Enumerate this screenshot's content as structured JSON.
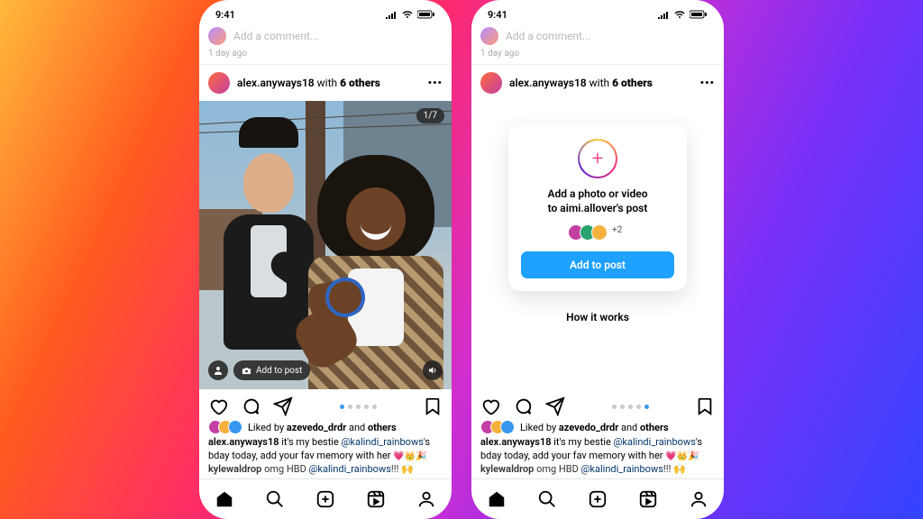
{
  "status": {
    "time": "9:41"
  },
  "prev_comment": {
    "placeholder": "Add a comment...",
    "timestamp": "1 day ago"
  },
  "post": {
    "username": "alex.anyways18",
    "with_text": " with ",
    "others_text": "6 others",
    "page_badge": "1/7",
    "add_to_post_pill": "Add to post"
  },
  "likes": {
    "prefix": "Liked by ",
    "user": "azevedo_drdr",
    "suffix": " and ",
    "others": "others"
  },
  "caption": {
    "user": "alex.anyways18",
    "body_before": " it's my bestie ",
    "mention": "@kalindi_rainbows",
    "body_after": "'s bday today, add your fav memory with her ",
    "emojis": "💗👑🎉"
  },
  "comment_cut": {
    "user": "kylewaldrop",
    "before": " omg HBD ",
    "mention": "@kalindi_rainbows",
    "after": "!!!  🙌"
  },
  "slide2": {
    "card_line1": "Add a photo or video",
    "card_line2": "to aimi.allover's post",
    "extra_count": "+2",
    "button": "Add to post",
    "how": "How it works"
  },
  "carousel": {
    "left_active_index": 1,
    "right_active_index": 4,
    "count": 5
  }
}
